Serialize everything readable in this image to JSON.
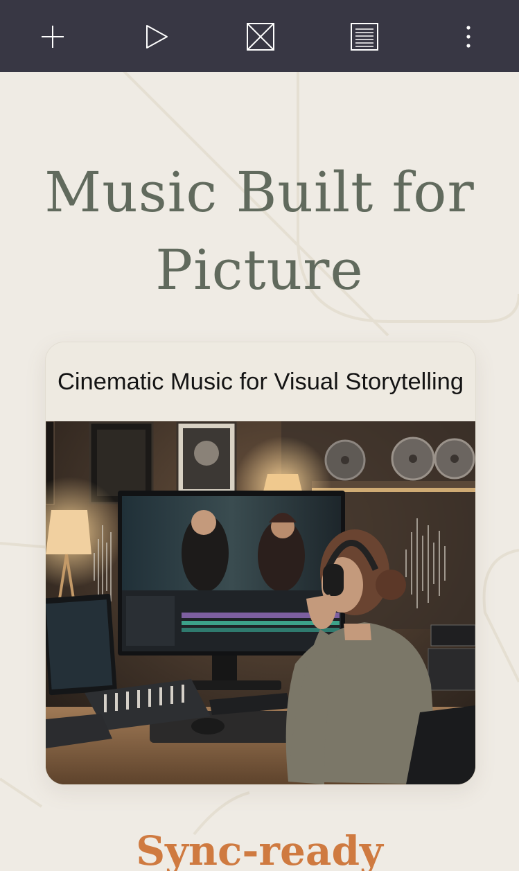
{
  "toolbar": {
    "buttons": [
      {
        "name": "add-button",
        "icon": "plus-icon"
      },
      {
        "name": "play-button",
        "icon": "play-icon"
      },
      {
        "name": "image-placeholder-button",
        "icon": "image-box-icon"
      },
      {
        "name": "text-block-button",
        "icon": "lines-icon"
      },
      {
        "name": "more-options-button",
        "icon": "more-vertical-icon"
      }
    ],
    "colors": {
      "background": "#383744",
      "icon": "#ffffff"
    }
  },
  "hero": {
    "title": "Music Built for Picture",
    "color": "#616a5d"
  },
  "card": {
    "caption": "Cinematic Music for Visual Storytelling",
    "image": "studio-editor-scene-image"
  },
  "section": {
    "heading": "Sync-ready",
    "color": "#cf7a40"
  },
  "page": {
    "background": "#efebe4"
  }
}
